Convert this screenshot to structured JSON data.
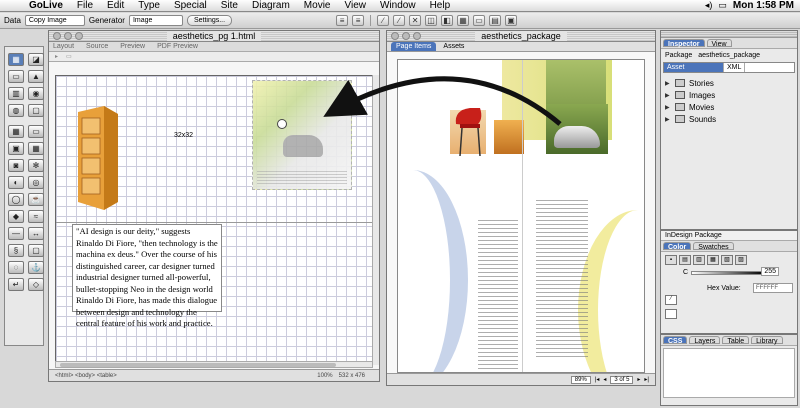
{
  "menubar": {
    "app": "GoLive",
    "items": [
      "File",
      "Edit",
      "Type",
      "Special",
      "Site",
      "Diagram",
      "Movie",
      "View",
      "Window",
      "Help"
    ],
    "clock": "Mon 1:58 PM"
  },
  "toolbar": {
    "data_label": "Data",
    "data_value": "Copy Image",
    "generator_label": "Generator",
    "generator_value": "Image",
    "settings_button": "Settings..."
  },
  "doc": {
    "title": "aesthetics_pg 1.html",
    "tabs": [
      "Layout",
      "Source",
      "Preview",
      "PDF Preview"
    ],
    "placeholder_size": "32x32",
    "text": "\"AI design is our deity,\" suggests Rinaldo Di Fiore, \"then technology is the machina ex deus.\" Over the course of his distinguished career, car designer turned industrial designer turned all-powerful, bullet-stopping Neo in the design world Rinaldo Di Fiore, has made this dialogue between design and technology the central feature of his work and practice.",
    "status_path": "<html> <body> <table>",
    "zoom": "100%",
    "size": "532 x 476"
  },
  "package": {
    "title": "aesthetics_package",
    "tabs": [
      "Page Items",
      "Assets"
    ],
    "zoom": "89%",
    "page_indicator": "3 of 5"
  },
  "inspector": {
    "tabs": [
      "Inspector",
      "View"
    ],
    "package_label": "Package",
    "package_name": "aesthetics_package",
    "columns": [
      "Asset",
      "XML"
    ],
    "tree": [
      {
        "label": "Stories",
        "icon": "stories-icon"
      },
      {
        "label": "Images",
        "icon": "images-icon"
      },
      {
        "label": "Movies",
        "icon": "movies-icon"
      },
      {
        "label": "Sounds",
        "icon": "sounds-icon"
      }
    ]
  },
  "indesign_package": {
    "title": "InDesign Package",
    "tabs": [
      "Color",
      "Swatches"
    ],
    "channel": "C",
    "channel_value": "255",
    "hex_label": "Hex Value:",
    "hex_value": "FFFFFF"
  },
  "bottom_palette": {
    "tabs": [
      "CSS",
      "Layers",
      "Table",
      "Library"
    ]
  }
}
